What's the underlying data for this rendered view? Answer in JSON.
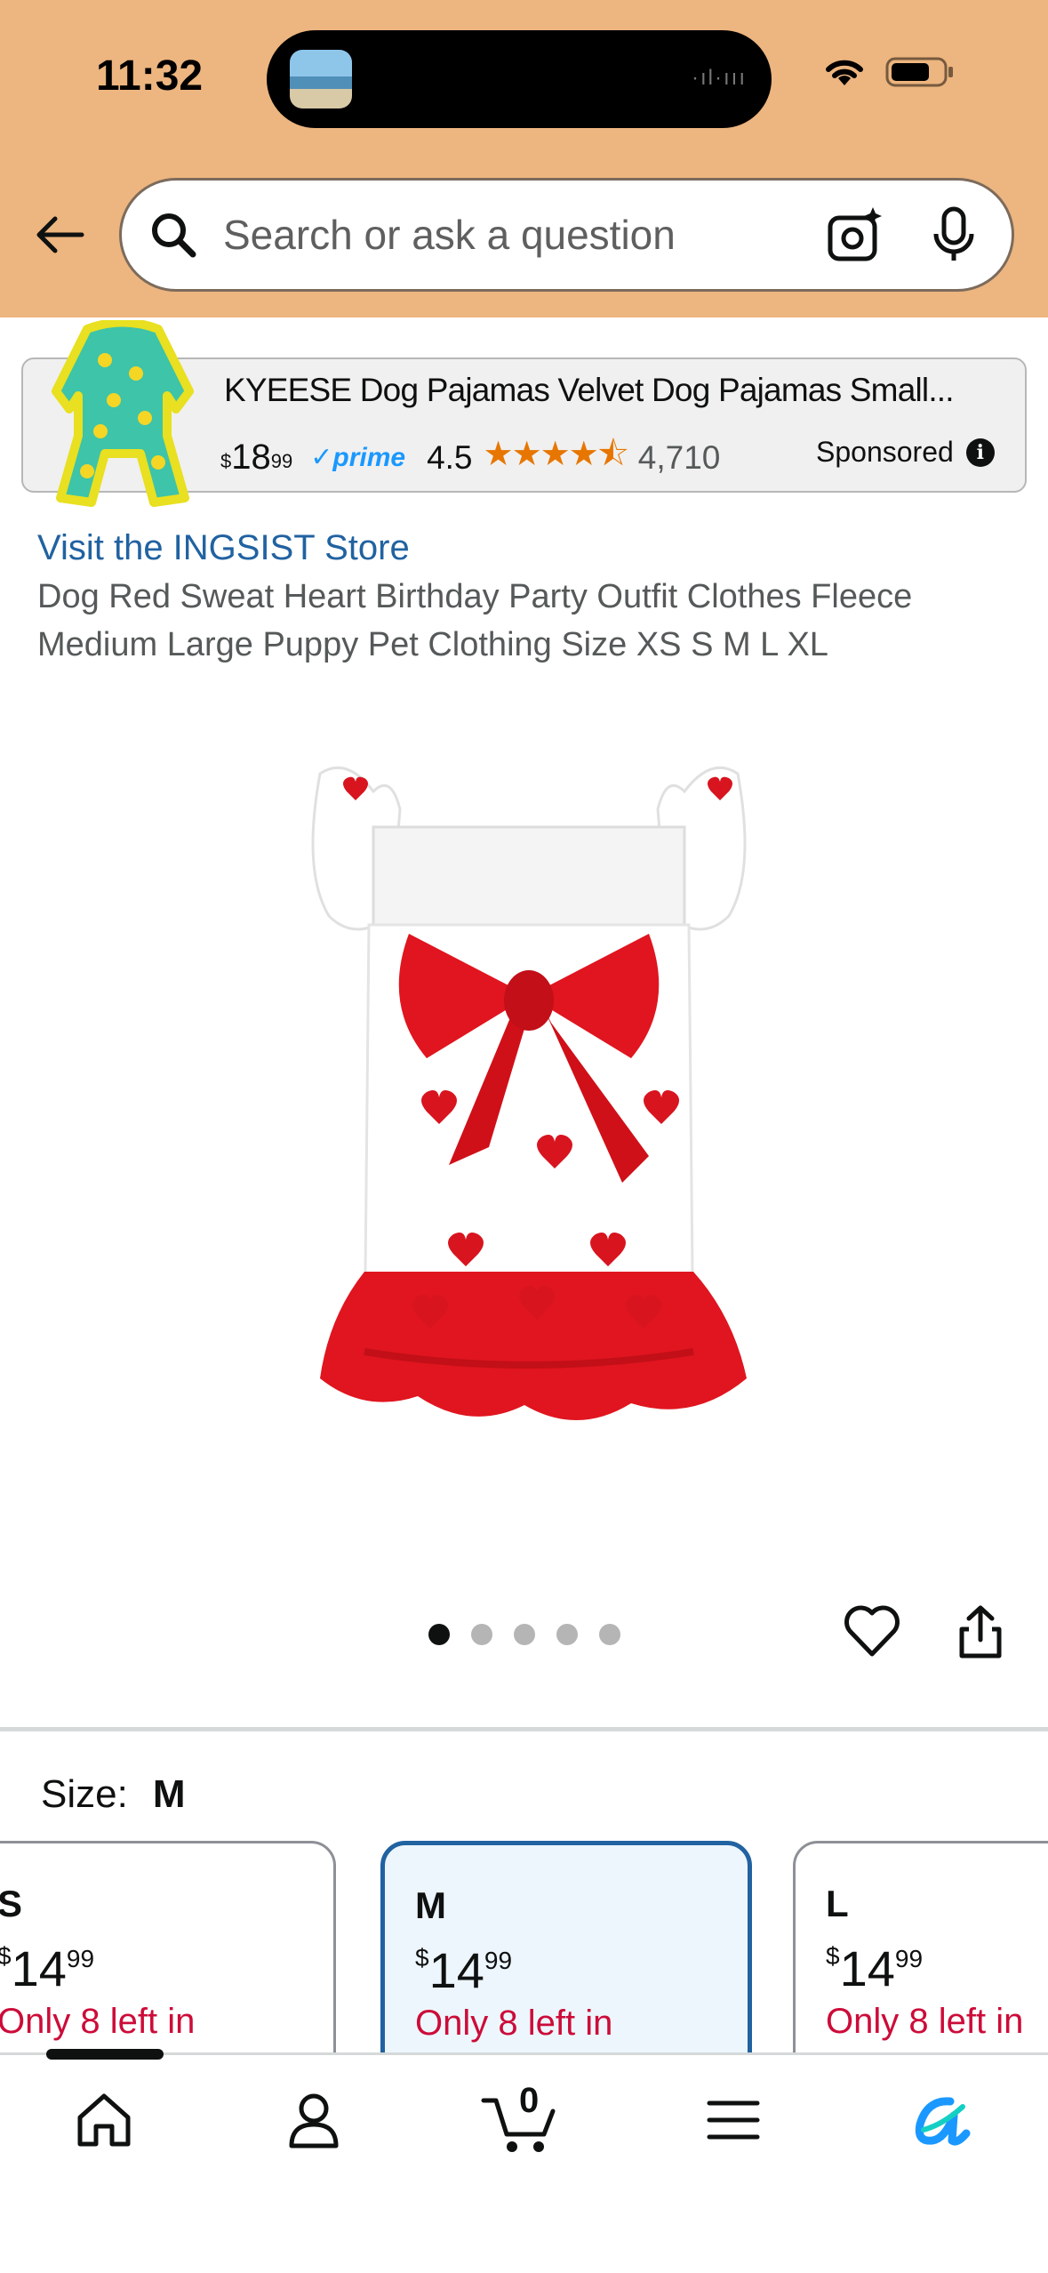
{
  "status_bar": {
    "time": "11:32"
  },
  "search": {
    "placeholder": "Search or ask a question"
  },
  "sponsored_ad": {
    "title": "KYEESE Dog Pajamas Velvet Dog Pajamas Small...",
    "price_currency": "$",
    "price_whole": "18",
    "price_cents": "99",
    "prime_label": "prime",
    "rating": "4.5",
    "stars": "★★★★⯪",
    "rating_count": "4,710",
    "sponsored_label": "Sponsored"
  },
  "product": {
    "store_link": "Visit the INGSIST Store",
    "title": "Dog Red Sweat Heart Birthday Party Outfit Clothes Fleece Medium Large Puppy Pet Clothing Size XS S M L XL",
    "image_count": 5,
    "active_image": 1
  },
  "size_selector": {
    "label": "Size:",
    "selected": "M",
    "options": [
      {
        "size": "S",
        "currency": "$",
        "whole": "14",
        "cents": "99",
        "stock": "Only 8 left in"
      },
      {
        "size": "M",
        "currency": "$",
        "whole": "14",
        "cents": "99",
        "stock": "Only 8 left in"
      },
      {
        "size": "L",
        "currency": "$",
        "whole": "14",
        "cents": "99",
        "stock": "Only 8 left in"
      }
    ]
  },
  "bottom_nav": {
    "cart_count": "0",
    "items": [
      "home-icon",
      "account-icon",
      "cart-icon",
      "menu-icon",
      "rufus-icon"
    ]
  },
  "colors": {
    "header_bg": "#edb57f",
    "link": "#2162a1",
    "stock_red": "#cc0c39",
    "star": "#e77600",
    "prime_blue": "#1a98ff",
    "selected_border": "#2162a1"
  }
}
